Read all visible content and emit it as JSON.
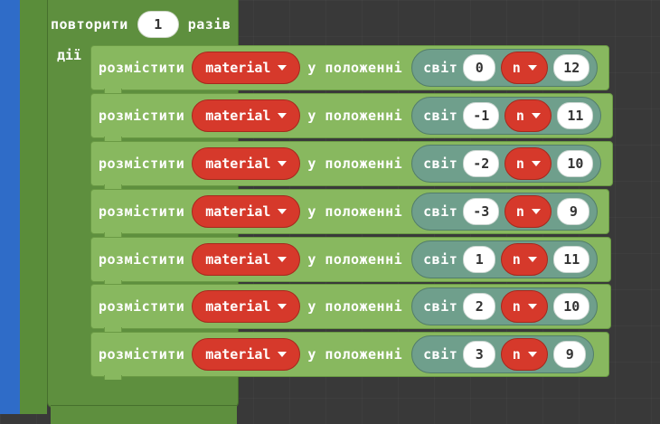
{
  "loop": {
    "repeat_label": "повторити",
    "times": "1",
    "times_label": "разів",
    "do_label": "дії"
  },
  "rows": [
    {
      "action": "розмістити",
      "material": "material",
      "position_label": "у положенні",
      "world": "світ",
      "x": "0",
      "n": "n",
      "z": "12"
    },
    {
      "action": "розмістити",
      "material": "material",
      "position_label": "у положенні",
      "world": "світ",
      "x": "-1",
      "n": "n",
      "z": "11"
    },
    {
      "action": "розмістити",
      "material": "material",
      "position_label": "у положенні",
      "world": "світ",
      "x": "-2",
      "n": "n",
      "z": "10"
    },
    {
      "action": "розмістити",
      "material": "material",
      "position_label": "у положенні",
      "world": "світ",
      "x": "-3",
      "n": "n",
      "z": "9"
    },
    {
      "action": "розмістити",
      "material": "material",
      "position_label": "у положенні",
      "world": "світ",
      "x": "1",
      "n": "n",
      "z": "11"
    },
    {
      "action": "розмістити",
      "material": "material",
      "position_label": "у положенні",
      "world": "світ",
      "x": "2",
      "n": "n",
      "z": "10"
    },
    {
      "action": "розмістити",
      "material": "material",
      "position_label": "у положенні",
      "world": "світ",
      "x": "3",
      "n": "n",
      "z": "9"
    }
  ]
}
